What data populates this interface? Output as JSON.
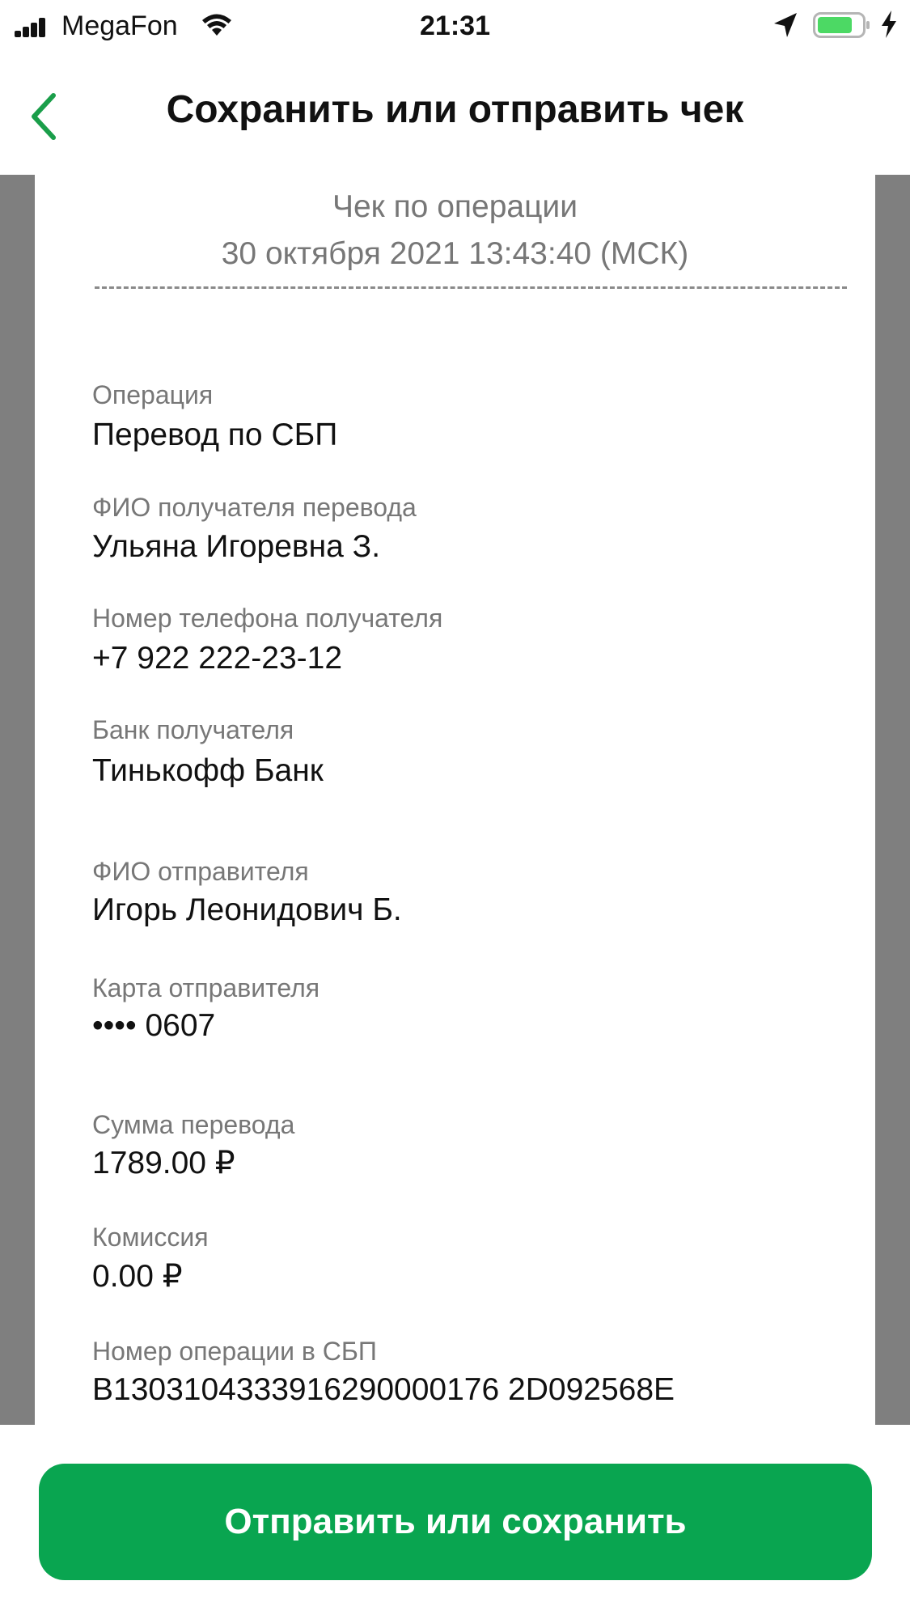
{
  "status_bar": {
    "carrier": "MegaFon",
    "time": "21:31"
  },
  "nav": {
    "title": "Сохранить или отправить чек"
  },
  "receipt": {
    "title": "Чек по операции",
    "datetime": "30 октября 2021 13:43:40 (МСК)",
    "fields": [
      {
        "label": "Операция",
        "value": "Перевод по СБП"
      },
      {
        "label": "ФИО получателя перевода",
        "value": "Ульяна Игоревна З."
      },
      {
        "label": "Номер телефона получателя",
        "value": "+7 922 222-23-12"
      },
      {
        "label": "Банк получателя",
        "value": "Тинькофф Банк"
      },
      {
        "label": "ФИО отправителя",
        "value": "Игорь Леонидович Б."
      },
      {
        "label": "Карта отправителя",
        "value": "•••• 0607"
      },
      {
        "label": "Сумма перевода",
        "value": "1789.00  ₽"
      },
      {
        "label": "Комиссия",
        "value": "0.00  ₽"
      },
      {
        "label": "Номер операции в СБП",
        "value": "B1303104333916290000176 2D092568E"
      }
    ]
  },
  "actions": {
    "primary_label": "Отправить или сохранить"
  },
  "colors": {
    "accent": "#09a550",
    "back_chevron": "#1a9e4a",
    "battery_fill": "#4cd964",
    "preview_bg": "#7f7f7f"
  }
}
